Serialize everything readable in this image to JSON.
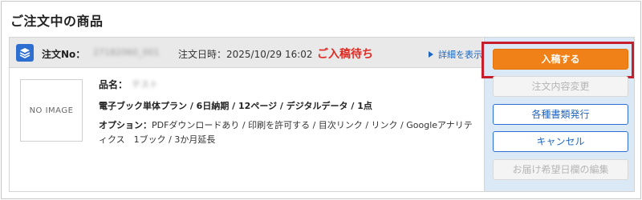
{
  "section": {
    "title": "ご注文中の商品"
  },
  "order": {
    "icon": "layers-icon",
    "order_no_label": "注文No：",
    "order_no_value": "27182060_001",
    "date_text": "注文日時：2025/10/29 16:02",
    "status": "ご入稿待ち",
    "detail_link": "詳細を表示"
  },
  "product": {
    "thumbnail_text": "NO IMAGE",
    "name_label": "品名：",
    "name_value": "テスト",
    "plan_line": "電子ブック単体プラン / 6日納期 / 12ページ / デジタルデータ / 1点",
    "options_label": "オプション：",
    "options_text": "PDFダウンロードあり / 印刷を許可する / 目次リンク / リンク / Googleアナリティクス　1ブック / 3か月延長"
  },
  "actions": {
    "submit": "入稿する",
    "change_order": "注文内容変更",
    "issue_documents": "各種書類発行",
    "cancel": "キャンセル",
    "edit_delivery_date": "お届け希望日欄の編集"
  },
  "colors": {
    "accent": "#f08118",
    "status_red": "#e02a22",
    "link_blue": "#1f66c1",
    "highlight_red": "#c51f2e",
    "panel_blue": "#dbe9f6"
  }
}
